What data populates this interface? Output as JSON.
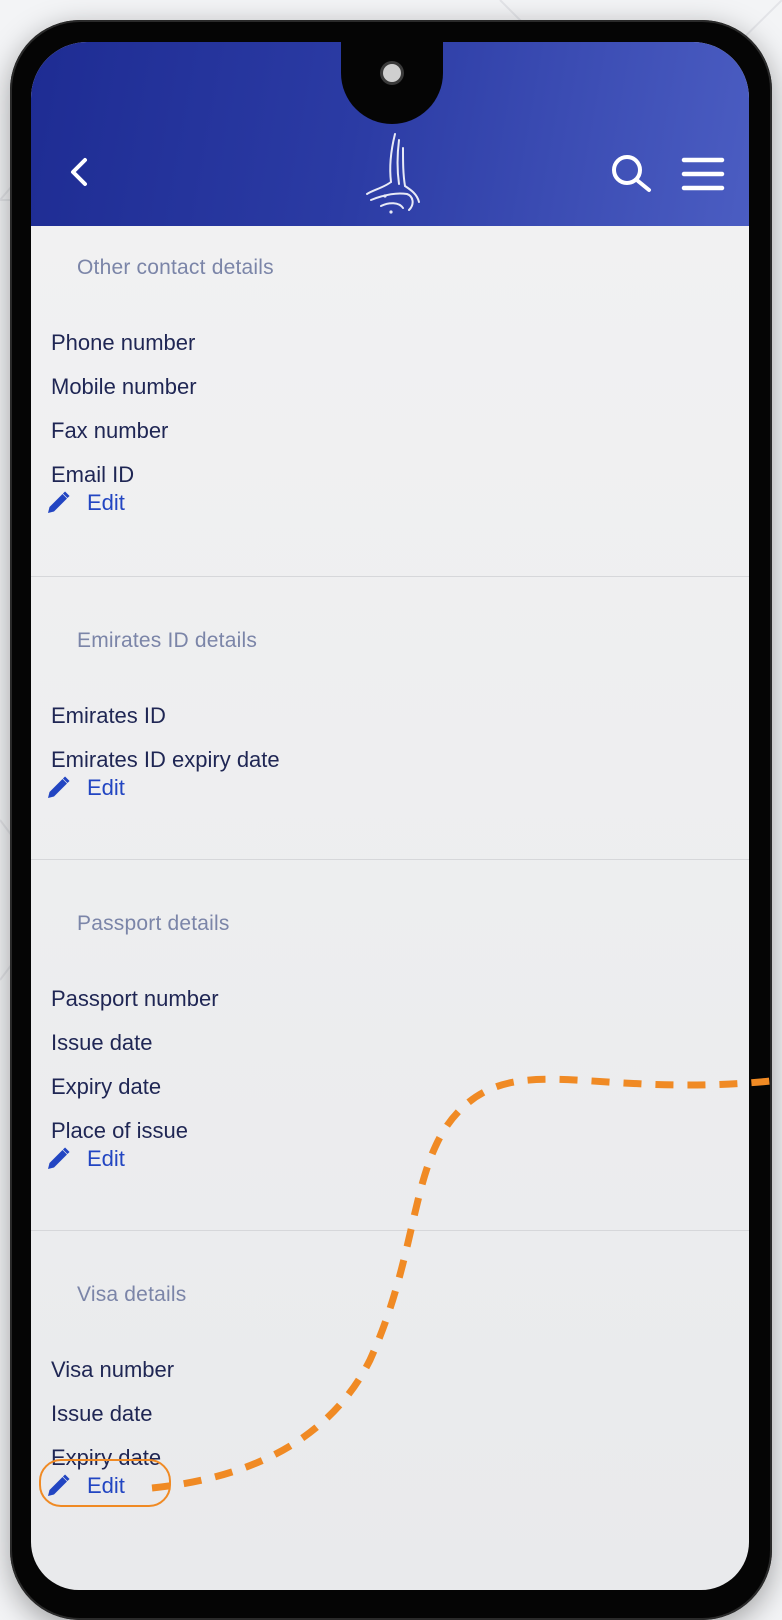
{
  "header": {
    "back_icon": "chevron-left-icon",
    "logo_icon": "calligraphy-logo-icon",
    "search_icon": "search-icon",
    "menu_icon": "hamburger-menu-icon",
    "gradient_start": "#1e2c93",
    "gradient_end": "#4b5dc2"
  },
  "sections": [
    {
      "title": "Other contact details",
      "fields": [
        "Phone number",
        "Mobile number",
        "Fax number",
        "Email ID"
      ],
      "edit_label": "Edit"
    },
    {
      "title": "Emirates ID details",
      "fields": [
        "Emirates ID",
        "Emirates ID expiry date"
      ],
      "edit_label": "Edit"
    },
    {
      "title": "Passport details",
      "fields": [
        "Passport number",
        "Issue date",
        "Expiry date",
        "Place of issue"
      ],
      "edit_label": "Edit"
    },
    {
      "title": "Visa details",
      "fields": [
        "Visa number",
        "Issue date",
        "Expiry date"
      ],
      "edit_label": "Edit"
    }
  ],
  "annotation": {
    "highlight_color": "#f08a24",
    "highlighted": "Visa details edit"
  },
  "colors": {
    "accent": "#2245c2",
    "section_title": "#7b85a8",
    "field_text": "#1f2654"
  }
}
